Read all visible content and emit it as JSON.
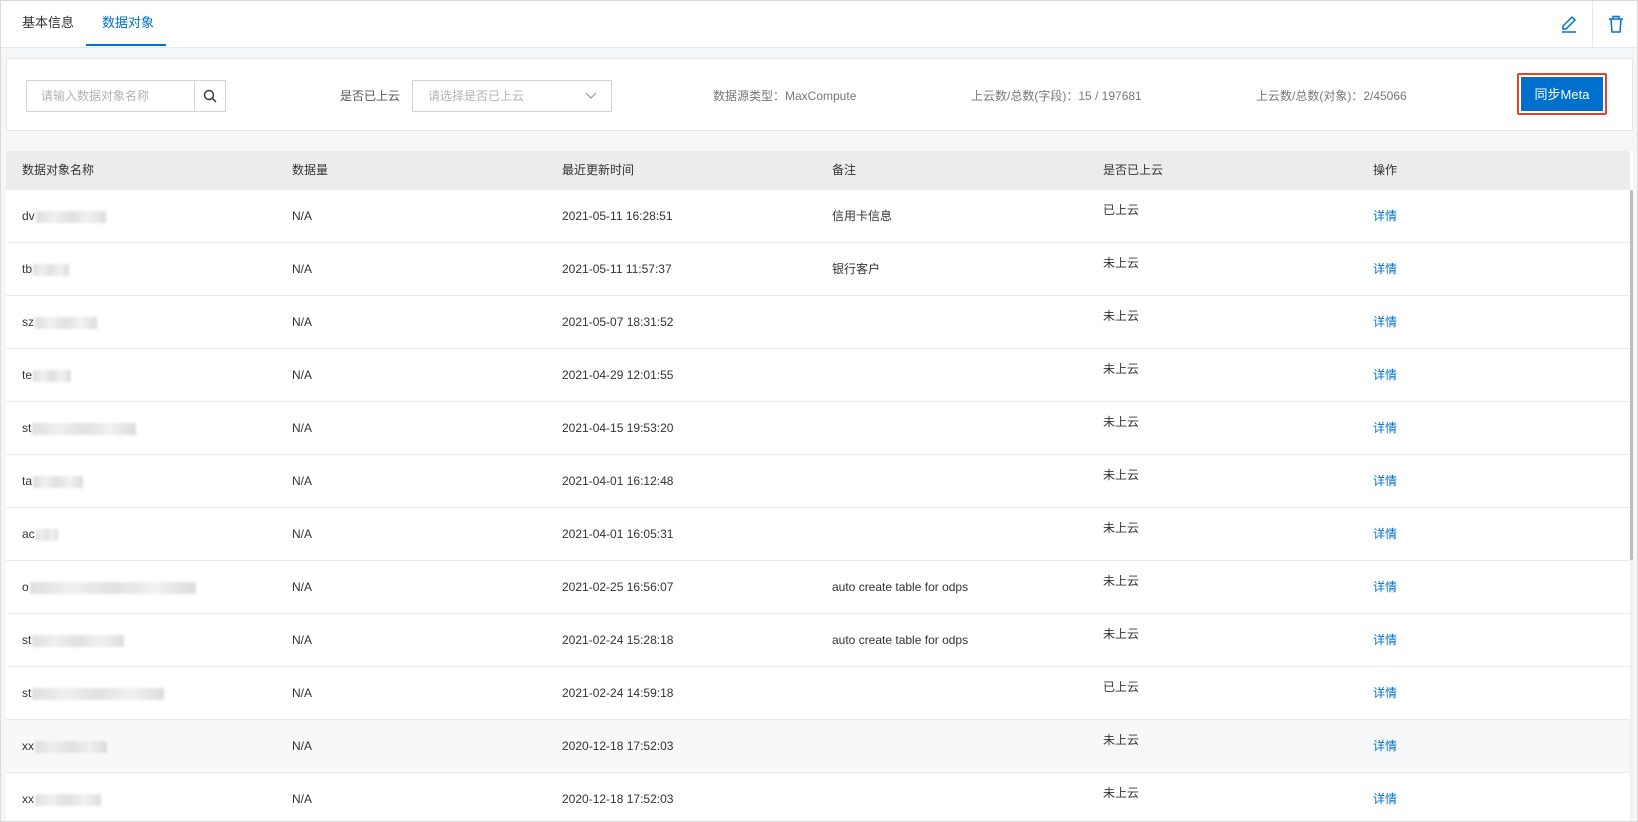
{
  "tabs": [
    {
      "label": "基本信息",
      "active": false
    },
    {
      "label": "数据对象",
      "active": true
    }
  ],
  "header_icons": [
    "edit-icon",
    "trash-icon"
  ],
  "filters": {
    "search_placeholder": "请输入数据对象名称",
    "cloud_label": "是否已上云",
    "cloud_placeholder": "请选择是否已上云",
    "source_type": "数据源类型：MaxCompute",
    "field_stats": "上云数/总数(字段)：15 / 197681",
    "object_stats": "上云数/总数(对象)：2/45066",
    "sync_button": "同步Meta"
  },
  "table": {
    "columns": [
      "数据对象名称",
      "数据量",
      "最近更新时间",
      "备注",
      "是否已上云",
      "操作"
    ],
    "rows": [
      {
        "name": "dv",
        "volume": "N/A",
        "updated": "2021-05-11 16:28:51",
        "note": "信用卡信息",
        "cloud": "已上云",
        "action": "详情"
      },
      {
        "name": "tb",
        "volume": "N/A",
        "updated": "2021-05-11 11:57:37",
        "note": "银行客户",
        "cloud": "未上云",
        "action": "详情"
      },
      {
        "name": "sz",
        "volume": "N/A",
        "updated": "2021-05-07 18:31:52",
        "note": "",
        "cloud": "未上云",
        "action": "详情"
      },
      {
        "name": "te",
        "volume": "N/A",
        "updated": "2021-04-29 12:01:55",
        "note": "",
        "cloud": "未上云",
        "action": "详情"
      },
      {
        "name": "st",
        "volume": "N/A",
        "updated": "2021-04-15 19:53:20",
        "note": "",
        "cloud": "未上云",
        "action": "详情"
      },
      {
        "name": "ta",
        "volume": "N/A",
        "updated": "2021-04-01 16:12:48",
        "note": "",
        "cloud": "未上云",
        "action": "详情"
      },
      {
        "name": "ac",
        "volume": "N/A",
        "updated": "2021-04-01 16:05:31",
        "note": "",
        "cloud": "未上云",
        "action": "详情"
      },
      {
        "name": "o",
        "volume": "N/A",
        "updated": "2021-02-25 16:56:07",
        "note": "auto create table for odps",
        "cloud": "未上云",
        "action": "详情"
      },
      {
        "name": "st",
        "volume": "N/A",
        "updated": "2021-02-24 15:28:18",
        "note": "auto create table for odps",
        "cloud": "未上云",
        "action": "详情"
      },
      {
        "name": "st",
        "volume": "N/A",
        "updated": "2021-02-24 14:59:18",
        "note": "",
        "cloud": "已上云",
        "action": "详情"
      },
      {
        "name": "xx",
        "volume": "N/A",
        "updated": "2020-12-18 17:52:03",
        "note": "",
        "cloud": "未上云",
        "action": "详情"
      },
      {
        "name": "xx",
        "volume": "N/A",
        "updated": "2020-12-18 17:52:03",
        "note": "",
        "cloud": "未上云",
        "action": "详情"
      }
    ]
  },
  "colors": {
    "accent": "#0070cc",
    "highlight_border": "#e0452a"
  }
}
